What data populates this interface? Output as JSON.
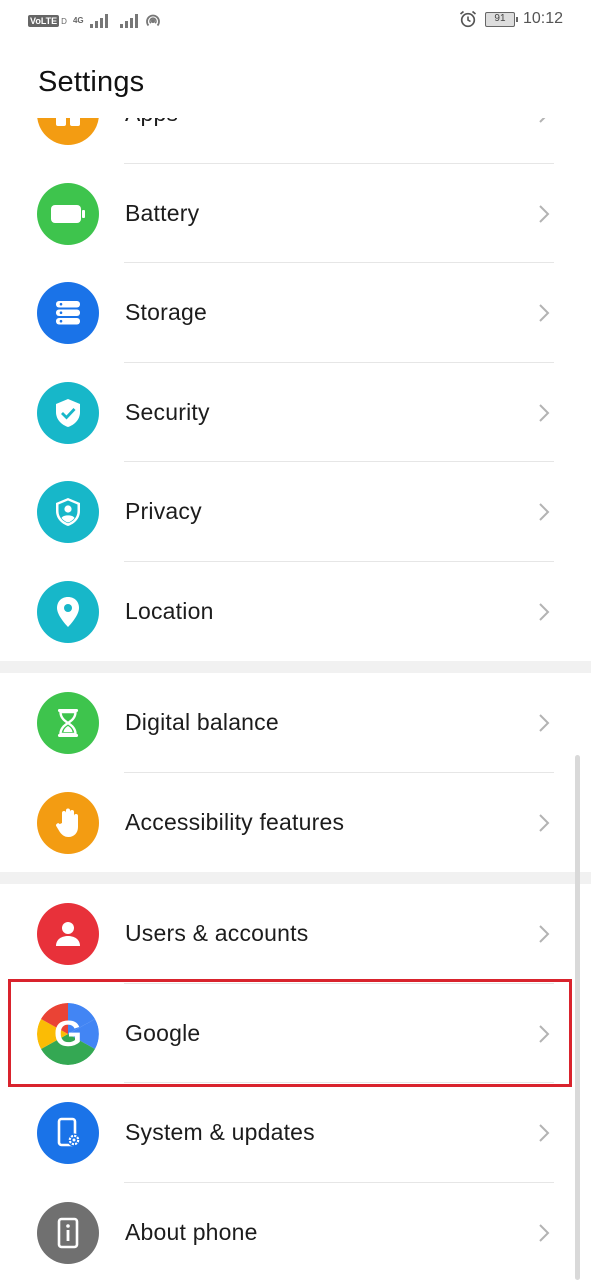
{
  "status_bar": {
    "volte": "VoLTE",
    "sim": "D",
    "network": "4G",
    "battery_level": "91",
    "time": "10:12"
  },
  "header": {
    "title": "Settings"
  },
  "sections": [
    {
      "items": [
        {
          "label": "Apps",
          "icon": "apps-icon",
          "color": "#f39c12"
        },
        {
          "label": "Battery",
          "icon": "battery-icon",
          "color": "#3ec44d"
        },
        {
          "label": "Storage",
          "icon": "storage-icon",
          "color": "#1a73e8"
        },
        {
          "label": "Security",
          "icon": "security-shield-icon",
          "color": "#17b7c9"
        },
        {
          "label": "Privacy",
          "icon": "privacy-icon",
          "color": "#17b7c9"
        },
        {
          "label": "Location",
          "icon": "location-pin-icon",
          "color": "#17b7c9"
        }
      ]
    },
    {
      "items": [
        {
          "label": "Digital balance",
          "icon": "hourglass-icon",
          "color": "#3ec44d"
        },
        {
          "label": "Accessibility features",
          "icon": "hand-icon",
          "color": "#f39c12"
        }
      ]
    },
    {
      "items": [
        {
          "label": "Users & accounts",
          "icon": "user-icon",
          "color": "#e8313a"
        },
        {
          "label": "Google",
          "icon": "google-icon",
          "color": "#4285f4"
        },
        {
          "label": "System & updates",
          "icon": "system-updates-icon",
          "color": "#1a73e8"
        },
        {
          "label": "About phone",
          "icon": "info-icon",
          "color": "#707070"
        }
      ]
    }
  ],
  "highlight_color": "#d9232d"
}
